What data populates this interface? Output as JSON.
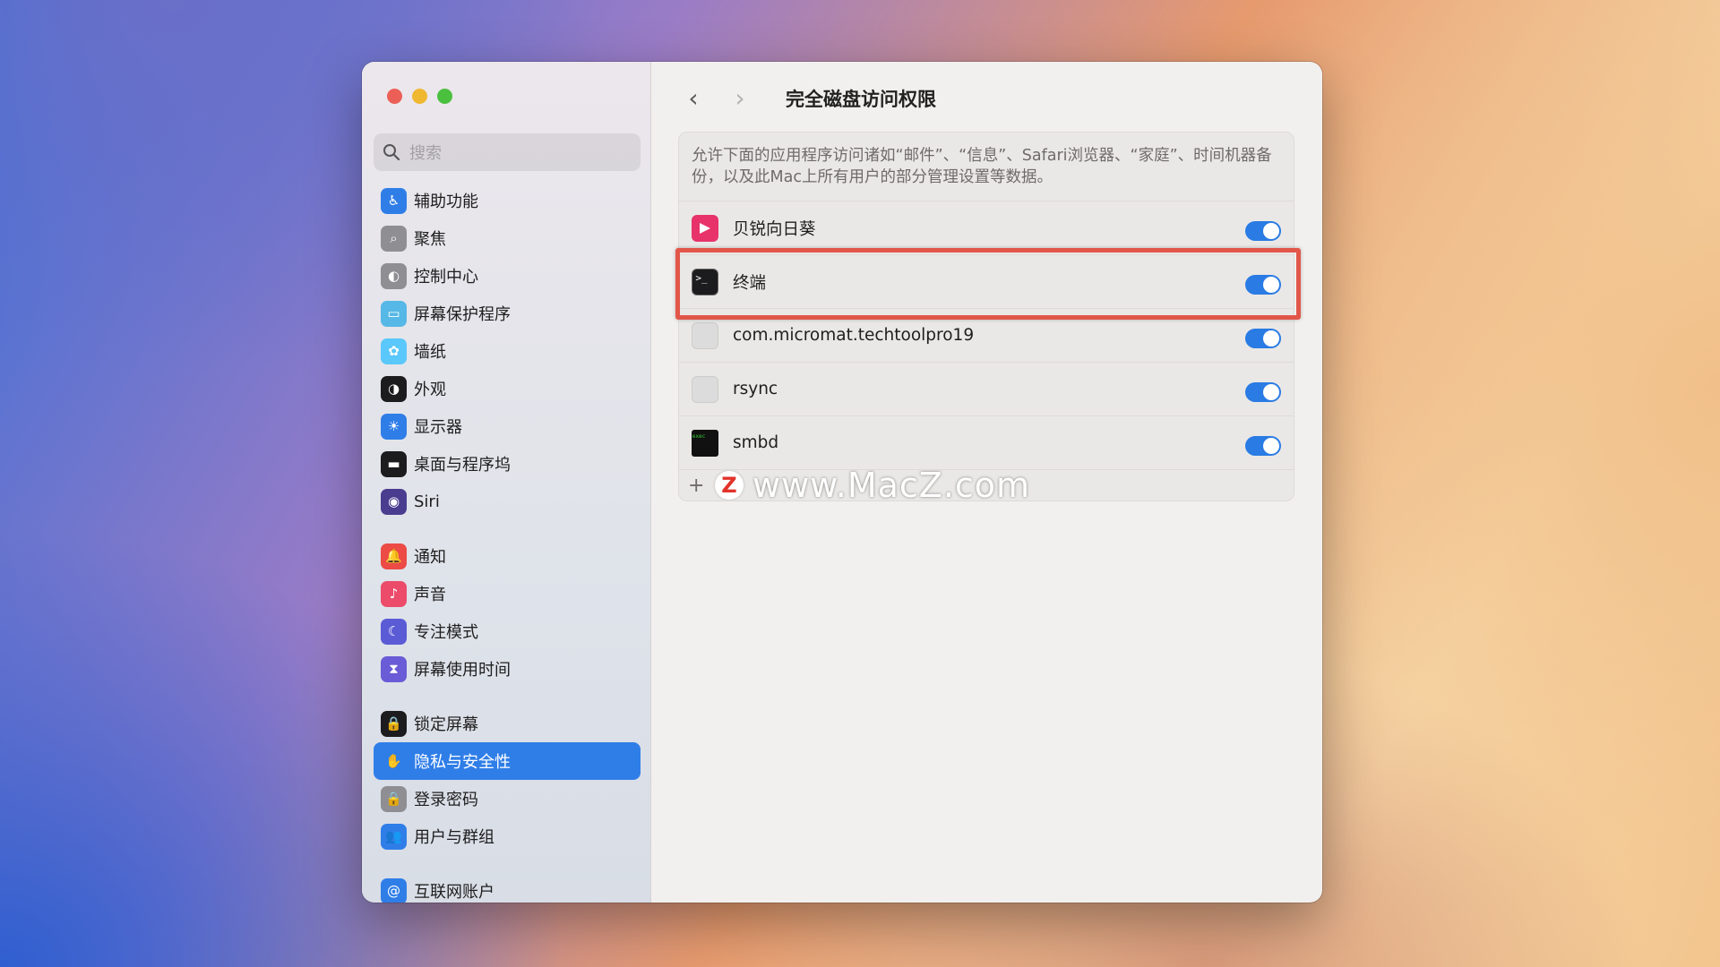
{
  "sidebar": {
    "search_placeholder": "搜索",
    "groups": [
      [
        {
          "label": "辅助功能",
          "icon": "accessibility-icon",
          "color": "#2f7ee8"
        },
        {
          "label": "聚焦",
          "icon": "spotlight-icon",
          "color": "#8e8e93"
        },
        {
          "label": "控制中心",
          "icon": "control-center-icon",
          "color": "#8e8e93"
        },
        {
          "label": "屏幕保护程序",
          "icon": "screensaver-icon",
          "color": "#56b8e6"
        },
        {
          "label": "墙纸",
          "icon": "wallpaper-icon",
          "color": "#5ac8fa"
        },
        {
          "label": "外观",
          "icon": "appearance-icon",
          "color": "#1c1c1e"
        },
        {
          "label": "显示器",
          "icon": "displays-icon",
          "color": "#2f7ee8"
        },
        {
          "label": "桌面与程序坞",
          "icon": "desktop-dock-icon",
          "color": "#1c1c1e"
        },
        {
          "label": "Siri",
          "icon": "siri-icon",
          "color": "#4a3d8f"
        }
      ],
      [
        {
          "label": "通知",
          "icon": "notifications-icon",
          "color": "#ec4b46"
        },
        {
          "label": "声音",
          "icon": "sound-icon",
          "color": "#ec4b6a"
        },
        {
          "label": "专注模式",
          "icon": "focus-icon",
          "color": "#5b5bd6"
        },
        {
          "label": "屏幕使用时间",
          "icon": "screen-time-icon",
          "color": "#6a5bd6"
        }
      ],
      [
        {
          "label": "锁定屏幕",
          "icon": "lock-screen-icon",
          "color": "#1c1c1e"
        },
        {
          "label": "隐私与安全性",
          "icon": "privacy-hand-icon",
          "color": "#2f7ee8",
          "active": true
        },
        {
          "label": "登录密码",
          "icon": "login-password-icon",
          "color": "#8e8e93"
        },
        {
          "label": "用户与群组",
          "icon": "users-groups-icon",
          "color": "#2f7ee8"
        }
      ],
      [
        {
          "label": "互联网账户",
          "icon": "internet-accounts-icon",
          "color": "#2f7ee8"
        }
      ]
    ]
  },
  "header": {
    "back_icon": "chevron-left-icon",
    "forward_icon": "chevron-right-icon",
    "title": "完全磁盘访问权限"
  },
  "panel": {
    "description": "允许下面的应用程序访问诸如“邮件”、“信息”、Safari浏览器、“家庭”、时间机器备份，以及此Mac上所有用户的部分管理设置等数据。",
    "apps": [
      {
        "name": "贝锐向日葵",
        "icon": "sunlogin-icon",
        "enabled": true
      },
      {
        "name": "终端",
        "icon": "terminal-icon",
        "enabled": true
      },
      {
        "name": "com.micromat.techtoolpro19",
        "icon": "generic-app-icon",
        "enabled": true
      },
      {
        "name": "rsync",
        "icon": "generic-app-icon",
        "enabled": true
      },
      {
        "name": "smbd",
        "icon": "exec-icon",
        "enabled": true
      }
    ],
    "add_label": "+"
  },
  "watermark": {
    "logo_letter": "Z",
    "text": "www.MacZ.com"
  },
  "colors": {
    "accent": "#2f7ee8",
    "toggle_on": "#2a7be4",
    "highlight_border": "#e2564a"
  }
}
